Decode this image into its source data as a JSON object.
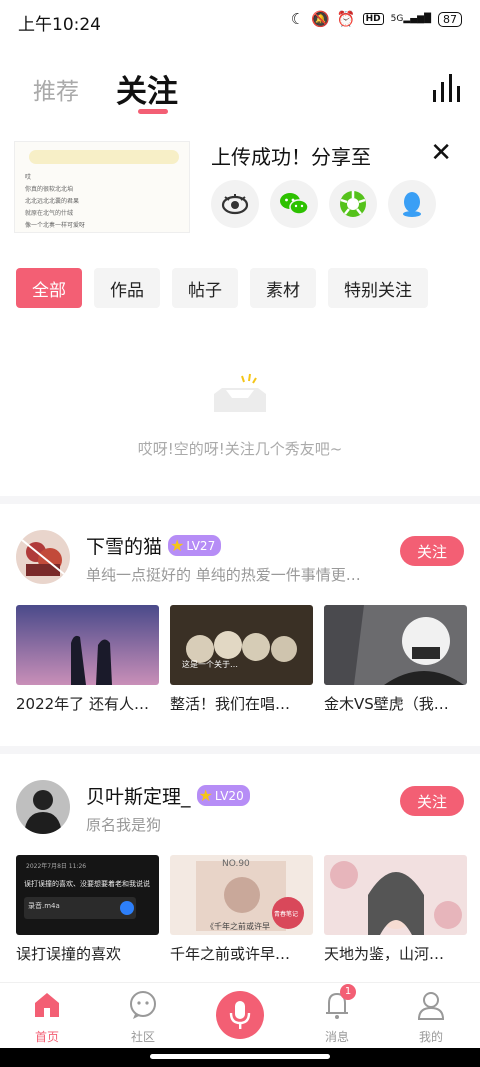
{
  "status": {
    "time": "上午10:24",
    "network": "5G",
    "battery": "87"
  },
  "tabs": {
    "recommend": "推荐",
    "following": "关注"
  },
  "upload": {
    "title": "上传成功！分享至",
    "thumb_text": [
      "哎",
      "你真的很软北北垍",
      "北北远北北囊的君果",
      "就原在北气的什绒",
      "像一个北奏一样可爱呀"
    ],
    "share_icons": [
      "eye-icon",
      "wechat-icon",
      "moments-icon",
      "qq-icon"
    ]
  },
  "filters": [
    "全部",
    "作品",
    "帖子",
    "素材",
    "特别关注"
  ],
  "empty_text": "哎呀!空的呀!关注几个秀友吧~",
  "users": [
    {
      "name": "下雪的猫",
      "level": "LV27",
      "desc": "单纯一点挺好的 单纯的热爱一件事情更…",
      "follow": "关注",
      "works": [
        "2022年了 还有人…",
        "整活！我们在唱…",
        "金木VS壁虎（我…"
      ]
    },
    {
      "name": "贝叶斯定理_",
      "level": "LV20",
      "desc": "原名我是狗",
      "follow": "关注",
      "works": [
        "误打误撞的喜欢",
        "千年之前或许早…",
        "天地为鉴，山河…"
      ]
    }
  ],
  "work_texts": {
    "w2": "这是一个关于…",
    "w4_date": "2022年7月8日 11:26",
    "w4_line1": "误打误撞的喜欢、没要想要着老和我说说",
    "w4_file": "录音.m4a",
    "w5_top": "NO.90",
    "w5_caption": "《千年之前或许早",
    "w5_stamp": "青春笔记"
  },
  "nav": {
    "home": "首页",
    "community": "社区",
    "messages": "消息",
    "mine": "我的",
    "badge": "1"
  }
}
